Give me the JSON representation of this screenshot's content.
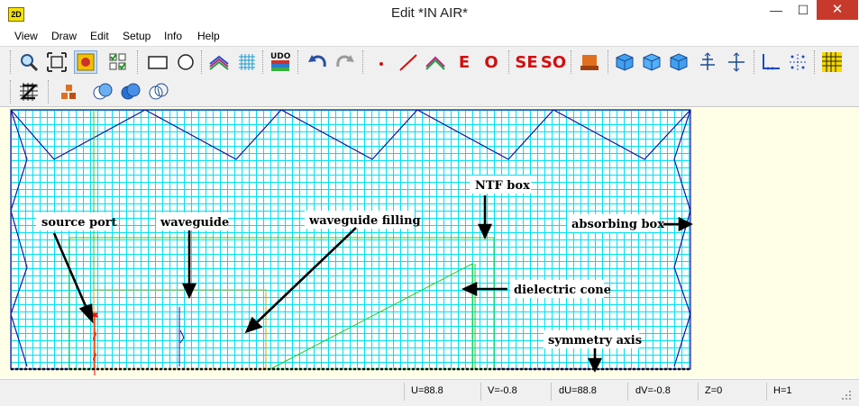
{
  "window": {
    "icon_label": "2D",
    "title": "Edit   *IN AIR*",
    "min_glyph": "—",
    "max_glyph": "☐",
    "close_glyph": "✕"
  },
  "menu": [
    "View",
    "Draw",
    "Edit",
    "Setup",
    "Info",
    "Help"
  ],
  "toolbar": {
    "udo": "UDO",
    "edge": "E",
    "other": "O",
    "source_edge": "SE",
    "source_other": "SO"
  },
  "canvas": {
    "labels": {
      "source_port": "source port",
      "waveguide": "waveguide",
      "waveguide_filling": "waveguide filling",
      "ntf_box": "NTF box",
      "absorbing_box": "absorbing box",
      "dielectric_cone": "dielectric cone",
      "symmetry_axis": "symmetry axis"
    },
    "colors": {
      "grid": "#00e0f0",
      "absorbing_box": "#1515a0",
      "ntf_box": "#22cc22",
      "waveguide": "#e8a000",
      "source_port": "#ff0000",
      "background": "#ffffe8"
    }
  },
  "status": {
    "u": "U=88.8",
    "v": "V=-0.8",
    "du": "dU=88.8",
    "dv": "dV=-0.8",
    "z": "Z=0",
    "h": "H=1"
  },
  "icons": {
    "zoom": "zoom-icon",
    "fit": "fit-view-icon",
    "view": "view-mode-icon",
    "checklist": "checklist-icon",
    "rectangle": "rectangle-icon",
    "circle": "circle-icon",
    "layers": "layers-icon",
    "grid": "grid-icon",
    "undo": "undo-icon",
    "redo": "redo-icon"
  }
}
